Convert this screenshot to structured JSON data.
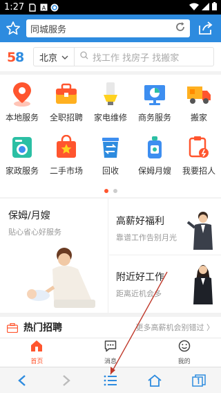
{
  "status": {
    "time": "1:27"
  },
  "browser": {
    "title": "同城服务"
  },
  "header": {
    "city": "北京",
    "search_placeholder": "找工作 找房子 找搬家"
  },
  "grid": [
    {
      "label": "本地服务",
      "icon": "location-pin-icon"
    },
    {
      "label": "全职招聘",
      "icon": "briefcase-icon"
    },
    {
      "label": "家电维修",
      "icon": "light-bulb-icon"
    },
    {
      "label": "商务服务",
      "icon": "chart-board-icon"
    },
    {
      "label": "搬家",
      "icon": "moving-truck-icon"
    },
    {
      "label": "家政服务",
      "icon": "washing-machine-icon"
    },
    {
      "label": "二手市场",
      "icon": "star-bag-icon"
    },
    {
      "label": "回收",
      "icon": "recycle-icon"
    },
    {
      "label": "保姆月嫂",
      "icon": "baby-bottle-icon"
    },
    {
      "label": "我要招人",
      "icon": "recruit-icon"
    }
  ],
  "promo": {
    "left_title": "保姆/月嫂",
    "left_sub": "贴心省心好服务",
    "right_top_title": "高薪好福利",
    "right_top_sub": "靠谱工作告别月光",
    "right_bot_title": "附近好工作",
    "right_bot_sub": "距离近机会多"
  },
  "hot": {
    "title": "热门招聘",
    "more": "更多高薪机会别错过 〉"
  },
  "tabs": [
    {
      "label": "首页",
      "icon": "home-icon",
      "active": true
    },
    {
      "label": "消息",
      "icon": "message-icon",
      "active": false
    },
    {
      "label": "我的",
      "icon": "smile-icon",
      "active": false
    }
  ],
  "colors": {
    "browser_blue": "#2d8bdf",
    "accent": "#ff552e"
  }
}
